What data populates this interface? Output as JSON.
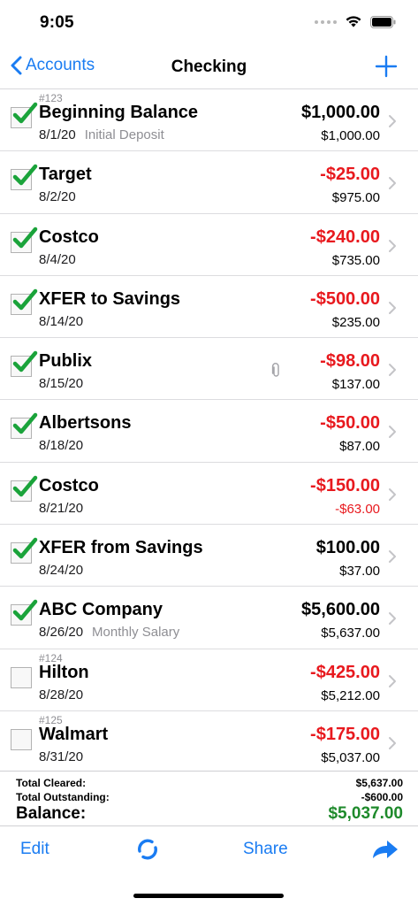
{
  "status_bar": {
    "time": "9:05"
  },
  "nav": {
    "back_label": "Accounts",
    "title": "Checking",
    "add_icon": "plus-icon"
  },
  "transactions": [
    {
      "number": "#123",
      "payee": "Beginning Balance",
      "date": "8/1/20",
      "memo": "Initial Deposit",
      "amount": "$1,000.00",
      "balance": "$1,000.00",
      "cleared": true,
      "attachment": false,
      "amount_negative": false,
      "balance_negative": false
    },
    {
      "number": "",
      "payee": "Target",
      "date": "8/2/20",
      "memo": "",
      "amount": "-$25.00",
      "balance": "$975.00",
      "cleared": true,
      "attachment": false,
      "amount_negative": true,
      "balance_negative": false
    },
    {
      "number": "",
      "payee": "Costco",
      "date": "8/4/20",
      "memo": "",
      "amount": "-$240.00",
      "balance": "$735.00",
      "cleared": true,
      "attachment": false,
      "amount_negative": true,
      "balance_negative": false
    },
    {
      "number": "",
      "payee": "XFER to Savings",
      "date": "8/14/20",
      "memo": "",
      "amount": "-$500.00",
      "balance": "$235.00",
      "cleared": true,
      "attachment": false,
      "amount_negative": true,
      "balance_negative": false
    },
    {
      "number": "",
      "payee": "Publix",
      "date": "8/15/20",
      "memo": "",
      "amount": "-$98.00",
      "balance": "$137.00",
      "cleared": true,
      "attachment": true,
      "amount_negative": true,
      "balance_negative": false
    },
    {
      "number": "",
      "payee": "Albertsons",
      "date": "8/18/20",
      "memo": "",
      "amount": "-$50.00",
      "balance": "$87.00",
      "cleared": true,
      "attachment": false,
      "amount_negative": true,
      "balance_negative": false
    },
    {
      "number": "",
      "payee": "Costco",
      "date": "8/21/20",
      "memo": "",
      "amount": "-$150.00",
      "balance": "-$63.00",
      "cleared": true,
      "attachment": false,
      "amount_negative": true,
      "balance_negative": true
    },
    {
      "number": "",
      "payee": "XFER from Savings",
      "date": "8/24/20",
      "memo": "",
      "amount": "$100.00",
      "balance": "$37.00",
      "cleared": true,
      "attachment": false,
      "amount_negative": false,
      "balance_negative": false
    },
    {
      "number": "",
      "payee": "ABC Company",
      "date": "8/26/20",
      "memo": "Monthly Salary",
      "amount": "$5,600.00",
      "balance": "$5,637.00",
      "cleared": true,
      "attachment": false,
      "amount_negative": false,
      "balance_negative": false
    },
    {
      "number": "#124",
      "payee": "Hilton",
      "date": "8/28/20",
      "memo": "",
      "amount": "-$425.00",
      "balance": "$5,212.00",
      "cleared": false,
      "attachment": false,
      "amount_negative": true,
      "balance_negative": false
    },
    {
      "number": "#125",
      "payee": "Walmart",
      "date": "8/31/20",
      "memo": "",
      "amount": "-$175.00",
      "balance": "$5,037.00",
      "cleared": false,
      "attachment": false,
      "amount_negative": true,
      "balance_negative": false
    }
  ],
  "summary": {
    "cleared_label": "Total Cleared:",
    "cleared_value": "$5,637.00",
    "outstanding_label": "Total Outstanding:",
    "outstanding_value": "-$600.00",
    "balance_label": "Balance:",
    "balance_value": "$5,037.00"
  },
  "toolbar": {
    "edit_label": "Edit",
    "share_label": "Share",
    "sync_icon": "sync-icon",
    "forward_icon": "forward-arrow-icon"
  },
  "colors": {
    "accent": "#1a7cf2",
    "negative": "#e8191e",
    "positive_balance": "#1e8a2b",
    "checkmark": "#1aa33a"
  }
}
